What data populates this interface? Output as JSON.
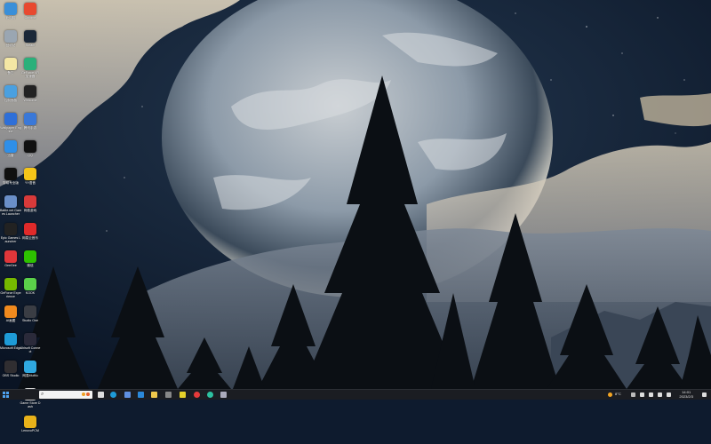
{
  "desktop": {
    "icons": [
      {
        "name": "icon-this-pc",
        "label": "此电脑",
        "color": "#3a8fd8"
      },
      {
        "name": "icon-recycle-bin",
        "label": "回收站",
        "color": "#9aa6b2"
      },
      {
        "name": "icon-notepad",
        "label": "备忘",
        "color": "#f4e7a4"
      },
      {
        "name": "icon-control-panel",
        "label": "控制面板",
        "color": "#4aa0e0"
      },
      {
        "name": "icon-wallpaper-engine",
        "label": "Wallpaper Engine",
        "color": "#2e6fd8"
      },
      {
        "name": "icon-app-blue",
        "label": "迅雷",
        "color": "#2f8fe8"
      },
      {
        "name": "icon-capcut",
        "label": "剪映专业版",
        "color": "#101010"
      },
      {
        "name": "icon-battlenet",
        "label": "Battle.net Games Launcher",
        "color": "#6a8fc8"
      },
      {
        "name": "icon-epic",
        "label": "Epic Games Launcher",
        "color": "#222222"
      },
      {
        "name": "icon-geeme",
        "label": "GeeGee",
        "color": "#e0363a"
      },
      {
        "name": "icon-nvidia",
        "label": "GeForce Experience",
        "color": "#76b900"
      },
      {
        "name": "icon-ai-tool",
        "label": "AI画图",
        "color": "#f08a1e"
      },
      {
        "name": "icon-edge",
        "label": "Microsoft Edge",
        "color": "#1e9bd7"
      },
      {
        "name": "icon-obs",
        "label": "OBS Studio",
        "color": "#302e31"
      },
      {
        "name": "icon-chrome",
        "label": "Chrome",
        "color": "#e8492f"
      },
      {
        "name": "icon-steam",
        "label": "Steam",
        "color": "#1b2838"
      },
      {
        "name": "icon-geforce-vr",
        "label": "GeForce VR 加速器",
        "color": "#2ab07a"
      },
      {
        "name": "icon-welcome",
        "label": "Welcome",
        "color": "#222222"
      },
      {
        "name": "icon-tencent",
        "label": "腾讯手游",
        "color": "#3a78d8"
      },
      {
        "name": "icon-qq",
        "label": "QQ",
        "color": "#111111"
      },
      {
        "name": "icon-yy",
        "label": "YY语音",
        "color": "#f5c518"
      },
      {
        "name": "icon-netease-game",
        "label": "网易游戏",
        "color": "#d83a3a"
      },
      {
        "name": "icon-netease-music",
        "label": "网易云音乐",
        "color": "#e02a2a"
      },
      {
        "name": "icon-wechat",
        "label": "微信",
        "color": "#2dc100"
      },
      {
        "name": "icon-kook",
        "label": "KOOK",
        "color": "#5bd04a"
      },
      {
        "name": "icon-studio-one",
        "label": "Studio One",
        "color": "#3a3d44"
      },
      {
        "name": "icon-ubisoft",
        "label": "Ubisoft Connect",
        "color": "#2a2a3a"
      },
      {
        "name": "icon-netease-mumu",
        "label": "网易MuMu",
        "color": "#2fa8e0"
      },
      {
        "name": "icon-game-store",
        "label": "Game Store Dash",
        "color": "#d0d0d0"
      },
      {
        "name": "icon-lenovo",
        "label": "LenovoPCM",
        "color": "#e8b21a"
      }
    ]
  },
  "taskbar": {
    "search_placeholder": "",
    "temperature": "8°C",
    "time": "14:01",
    "date": "2023/2/3"
  }
}
